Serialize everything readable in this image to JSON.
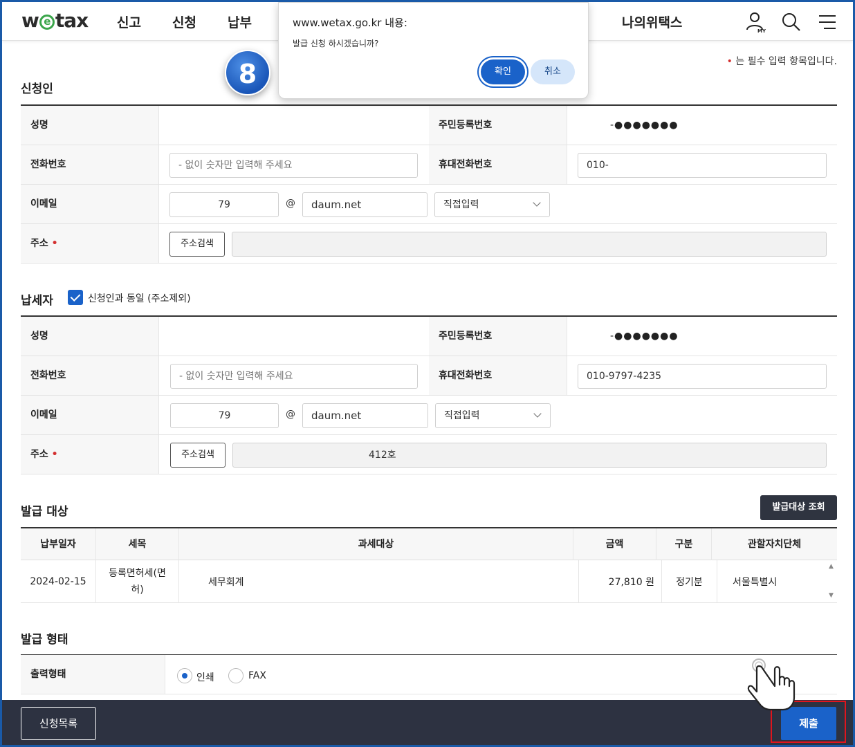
{
  "header": {
    "logo_prefix": "w",
    "logo_e": "e",
    "logo_suffix": "tax",
    "nav": [
      "신고",
      "신청",
      "납부",
      "나의위택스"
    ],
    "icons": [
      "my-page-icon",
      "search-icon",
      "menu-icon"
    ],
    "my_label": "MY"
  },
  "dialog": {
    "title": "www.wetax.go.kr 내용:",
    "message": "발급 신청 하시겠습니까?",
    "ok": "확인",
    "cancel": "취소"
  },
  "step_badge": "8",
  "required_note": "는 필수 입력 항목입니다.",
  "applicant": {
    "title": "신청인",
    "name_label": "성명",
    "rrn_label": "주민등록번호",
    "rrn_value": "-●●●●●●●",
    "phone_label": "전화번호",
    "phone_placeholder": "- 없이 숫자만 입력해 주세요",
    "mobile_label": "휴대전화번호",
    "mobile_value": "010-",
    "email_label": "이메일",
    "email_id": "79",
    "at": "@",
    "email_domain": "daum.net",
    "email_select": "직접입력",
    "address_label": "주소",
    "address_button": "주소검색"
  },
  "taxpayer": {
    "title": "납세자",
    "same_checkbox": "신청인과 동일 (주소제외)",
    "name_label": "성명",
    "rrn_label": "주민등록번호",
    "rrn_value": "-●●●●●●●",
    "phone_label": "전화번호",
    "phone_placeholder": "- 없이 숫자만 입력해 주세요",
    "mobile_label": "휴대전화번호",
    "mobile_value": "010-9797-4235",
    "email_label": "이메일",
    "email_id": "79",
    "at": "@",
    "email_domain": "daum.net",
    "email_select": "직접입력",
    "address_label": "주소",
    "address_button": "주소검색",
    "address_value": "412호"
  },
  "issue_target": {
    "title": "발급 대상",
    "lookup_button": "발급대상 조회",
    "columns": [
      "납부일자",
      "세목",
      "과세대상",
      "금액",
      "구분",
      "관할자치단체"
    ],
    "rows": [
      {
        "date": "2024-02-15",
        "tax": "등록면허세(면허)",
        "object": "세무회계",
        "amount": "27,810 원",
        "type": "정기분",
        "region": "서울특별시"
      }
    ]
  },
  "issue_form": {
    "title": "발급 형태",
    "output_label": "출력형태",
    "options": [
      "인쇄",
      "FAX"
    ],
    "selected": "인쇄"
  },
  "footer": {
    "list_button": "신청목록",
    "submit_button": "제출"
  },
  "colors": {
    "primary": "#1a62c9",
    "footer_bg": "#2d3241",
    "required": "#d32f2f",
    "highlight": "#e0151d"
  }
}
